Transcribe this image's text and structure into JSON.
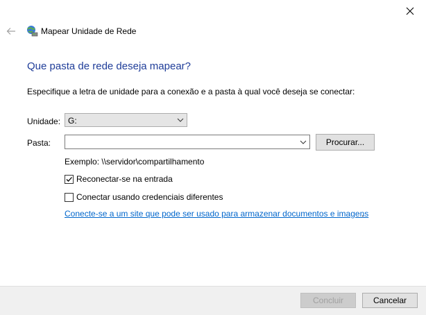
{
  "window": {
    "title": "Mapear Unidade de Rede"
  },
  "heading": "Que pasta de rede deseja mapear?",
  "instruction": "Especifique a letra de unidade para a conexão e a pasta à qual você deseja se conectar:",
  "drive": {
    "label": "Unidade:",
    "selected": "G:"
  },
  "folder": {
    "label": "Pasta:",
    "value": "",
    "browse_label": "Procurar..."
  },
  "example": "Exemplo: \\\\servidor\\compartilhamento",
  "options": {
    "reconnect_label": "Reconectar-se na entrada",
    "reconnect_checked": true,
    "credentials_label": "Conectar usando credenciais diferentes",
    "credentials_checked": false
  },
  "link": {
    "text": "Conecte-se a um site que pode ser usado para armazenar documentos e imagens",
    "suffix": "."
  },
  "footer": {
    "finish_label": "Concluir",
    "cancel_label": "Cancelar"
  },
  "colors": {
    "heading": "#1f3d99",
    "link": "#0066cc"
  }
}
